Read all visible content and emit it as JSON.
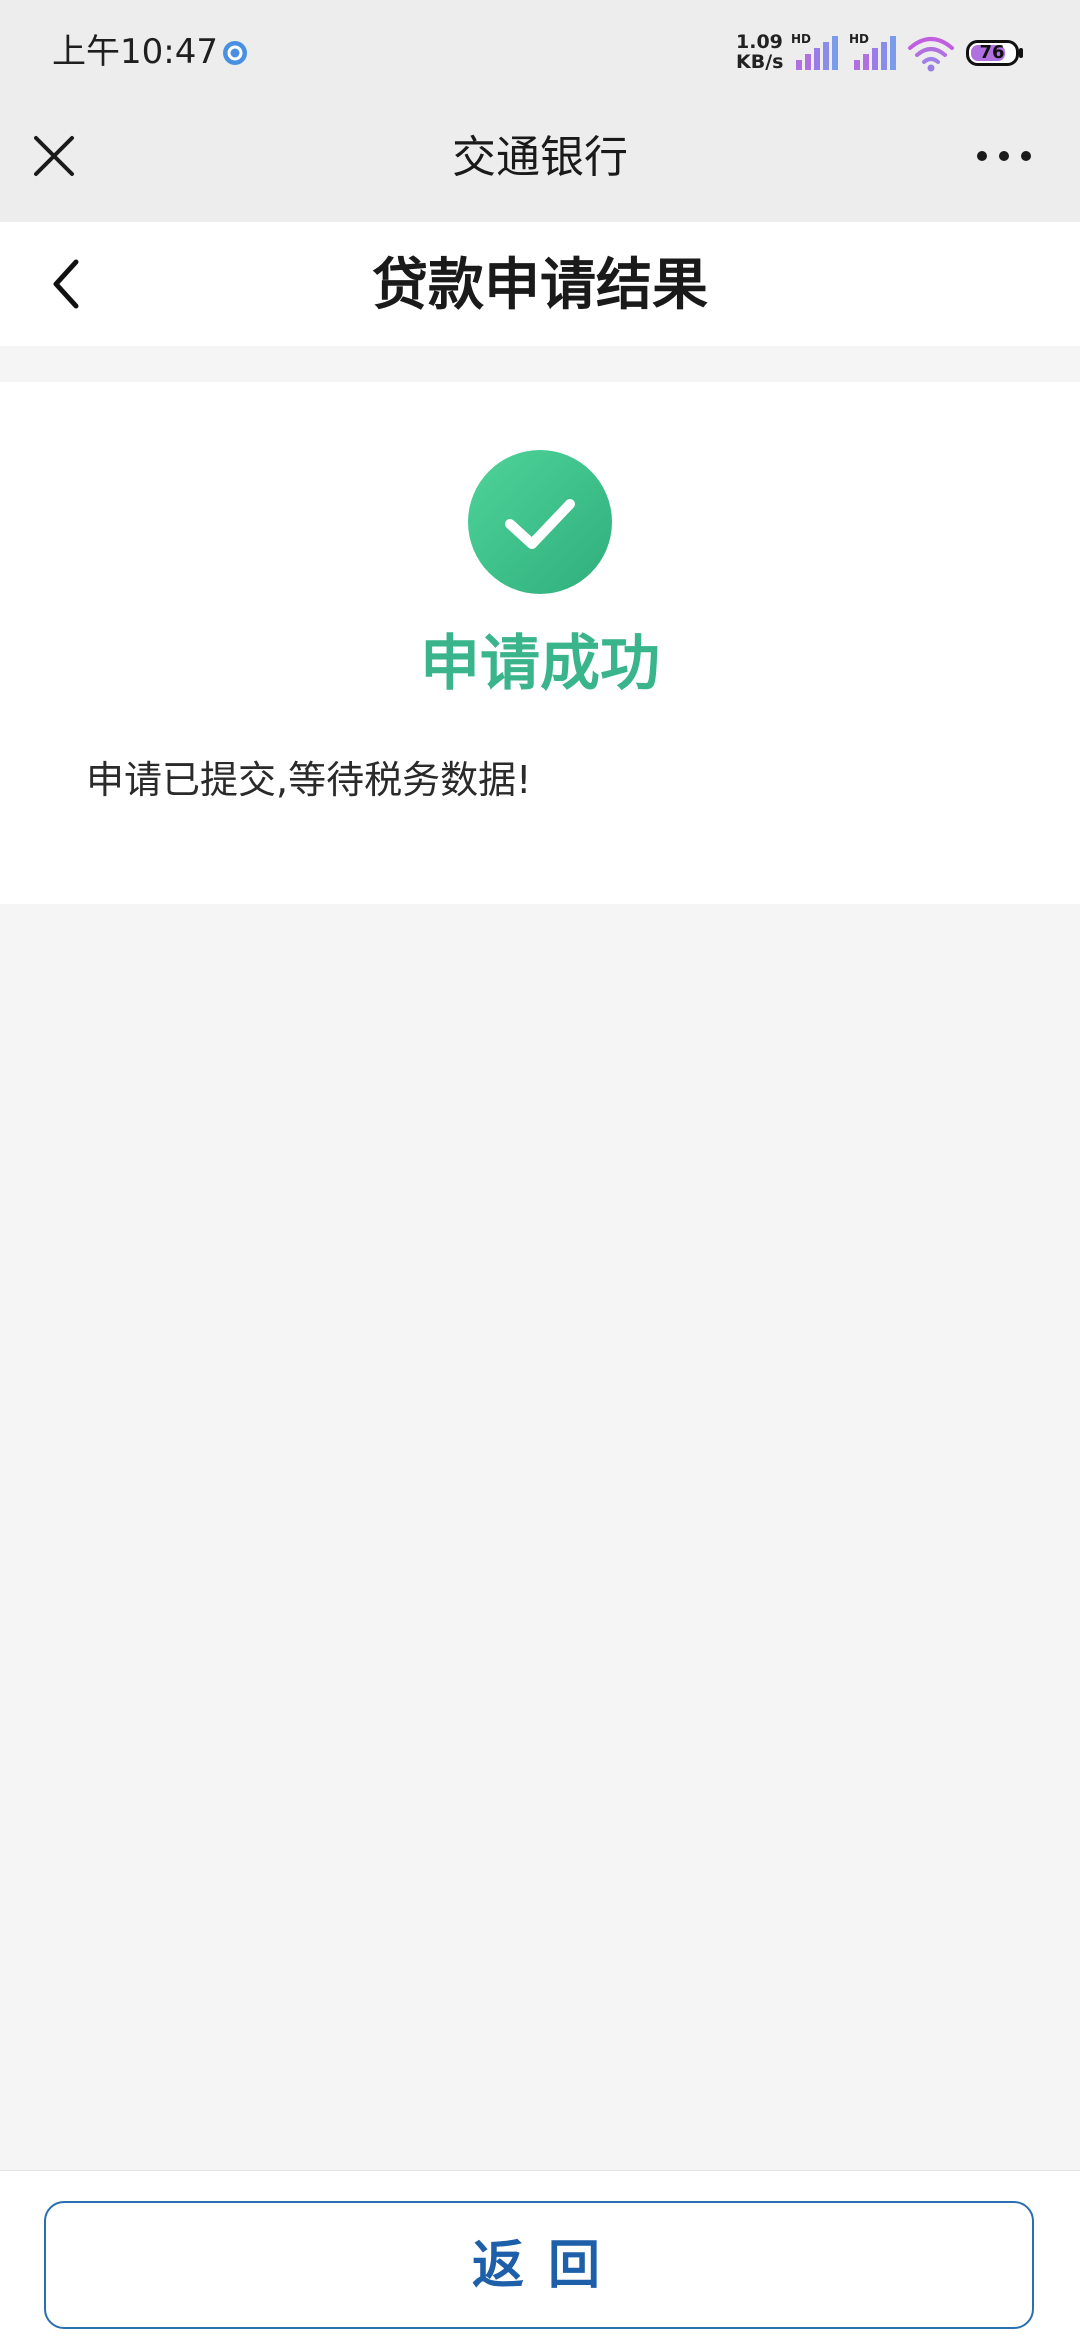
{
  "status_bar": {
    "time": "上午10:47",
    "net_speed_value": "1.09",
    "net_speed_unit": "KB/s",
    "signal1_label": "HD",
    "signal2_label": "HD",
    "battery": "76"
  },
  "top_bar": {
    "title": "交通银行"
  },
  "page_header": {
    "title": "贷款申请结果"
  },
  "result": {
    "title": "申请成功",
    "message": "申请已提交,等待税务数据!",
    "icon": "check-circle-icon"
  },
  "bottom": {
    "return_label": "返回"
  },
  "colors": {
    "success_green": "#3ab48a",
    "button_blue": "#1d5fa8",
    "background": "#f5f5f5"
  }
}
